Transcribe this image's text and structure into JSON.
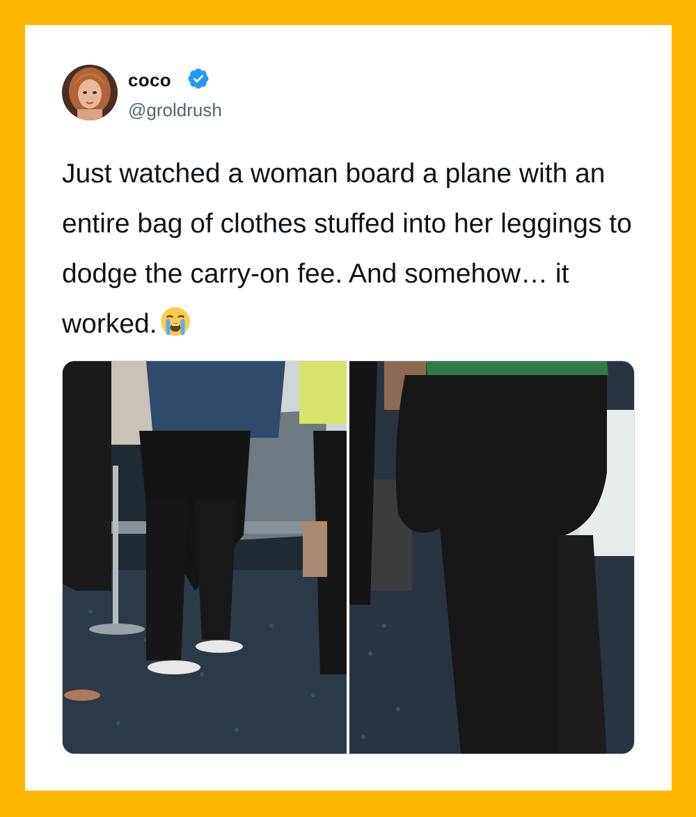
{
  "tweet": {
    "display_name": "coco",
    "handle": "@groldrush",
    "verified_icon": "verified-badge-icon",
    "text": "Just watched a woman board a plane with an entire bag of clothes stuffed into her leggings to dodge the carry-on fee. And somehow… it worked.",
    "emoji": "loudly-crying-face-emoji"
  },
  "colors": {
    "frame": "#FFB800",
    "card": "#FFFFFF",
    "text": "#0F1419",
    "muted": "#536471",
    "verified": "#1D9BF0"
  },
  "media": {
    "count": 2,
    "items": [
      {
        "name": "airport-gate-photo-left"
      },
      {
        "name": "airport-gate-photo-right"
      }
    ]
  }
}
